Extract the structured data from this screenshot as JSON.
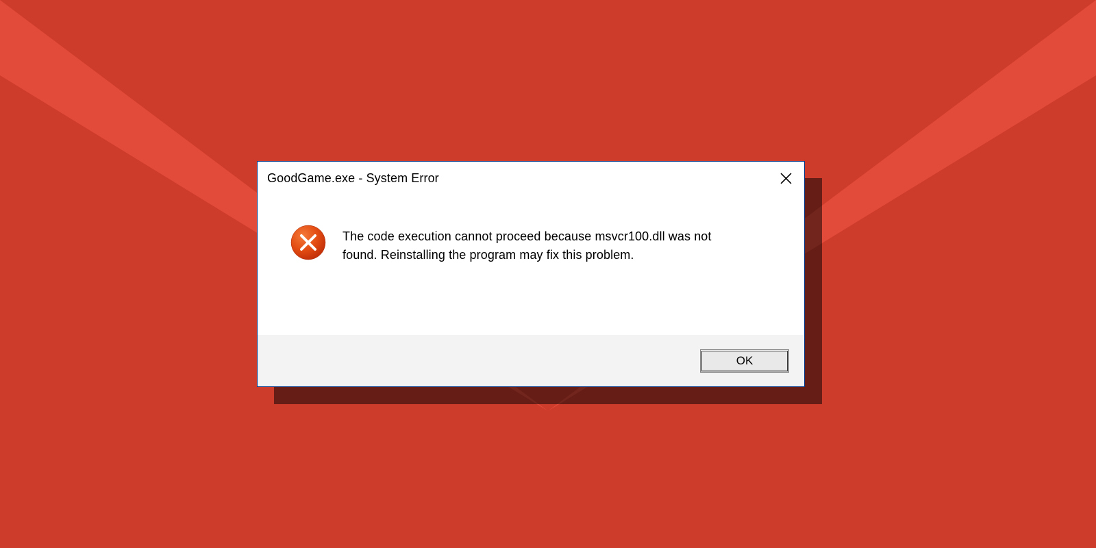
{
  "dialog": {
    "title": "GoodGame.exe - System Error",
    "message": "The code execution cannot proceed because msvcr100.dll was not found. Reinstalling the program may fix this problem.",
    "ok_label": "OK"
  },
  "colors": {
    "bg_base": "#e24b3a",
    "bg_dark": "#cd3b2a",
    "dialog_border": "#0a3a8a",
    "icon_fill": "#e34c12"
  }
}
